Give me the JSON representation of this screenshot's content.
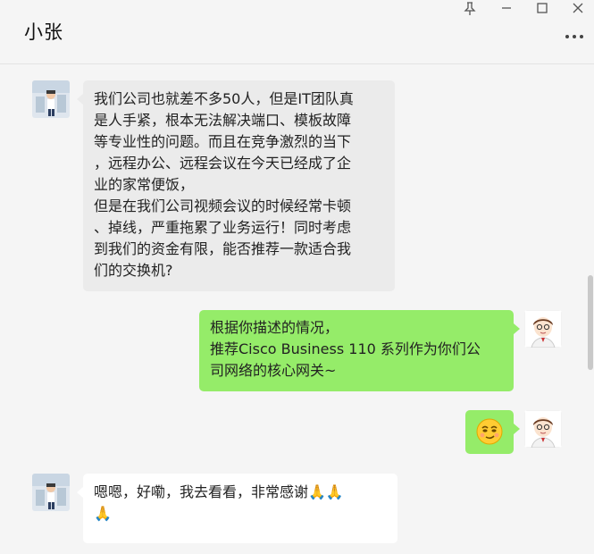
{
  "window": {
    "title": "小张",
    "pin_icon": "pin-icon",
    "minimize_icon": "minimize-icon",
    "maximize_icon": "maximize-icon",
    "close_icon": "close-icon",
    "more_icon": "more-dots-icon"
  },
  "messages": [
    {
      "from": "contact",
      "text": "我们公司也就差不多50人，但是IT团队真\n是人手紧，根本无法解决端口、模板故障\n等专业性的问题。而且在竞争激烈的当下\n，远程办公、远程会议在今天已经成了企\n业的家常便饭，\n但是在我们公司视频会议的时候经常卡顿\n、掉线，严重拖累了业务运行！同时考虑\n到我们的资金有限，能否推荐一款适合我\n们的交换机?"
    },
    {
      "from": "me",
      "text": "根据你描述的情况，\n推荐Cisco Business 110 系列作为你们公\n司网络的核心网关~"
    },
    {
      "from": "me",
      "emoji": "😏",
      "emoji_name": "smirk-emoji"
    },
    {
      "from": "contact",
      "text": "嗯嗯，好嘞，我去看看，非常感谢🙏🙏\n🙏"
    }
  ],
  "colors": {
    "sent_bubble": "#95ec69",
    "recv_bubble": "#ebebeb",
    "recv_bubble_white": "#ffffff",
    "background": "#f5f5f5"
  }
}
